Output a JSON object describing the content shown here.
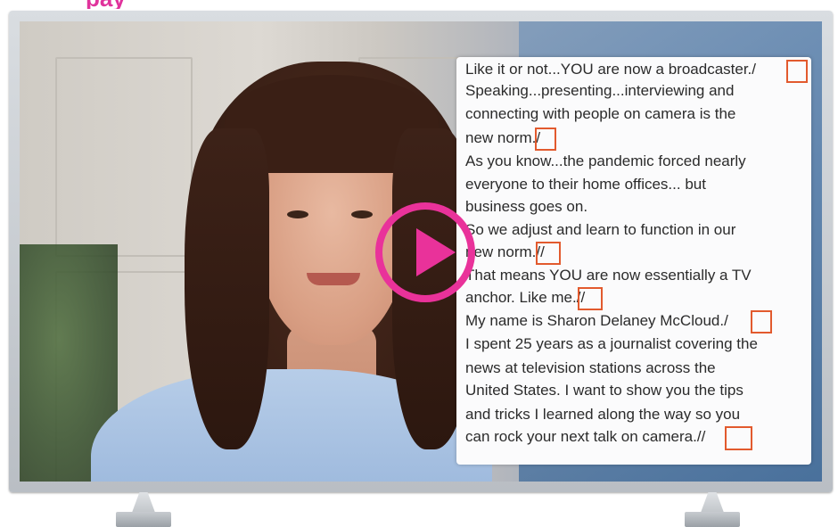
{
  "page": {
    "title_fragment": "pay",
    "accent_color": "#e9329a",
    "mark_color": "#e25a2e"
  },
  "video": {
    "play_icon": "play-circle-icon"
  },
  "transcript": {
    "lines": [
      "Like it or not...YOU are now a broadcaster./",
      "Speaking...presenting...interviewing and",
      "connecting with people on camera is the",
      "new norm./",
      "As you know...the pandemic forced nearly",
      "everyone to their home offices... but",
      "business goes on.",
      "So we adjust and learn to function in our",
      "new norm.//",
      "That means YOU are now essentially a TV",
      "anchor. Like me.//",
      "My name is Sharon Delaney McCloud./",
      "I spent 25 years as a journalist covering the",
      "news at television stations across the",
      "United States. I want to show you the tips",
      "and tricks I learned along the way so you",
      "can rock your next talk on camera.//"
    ]
  }
}
